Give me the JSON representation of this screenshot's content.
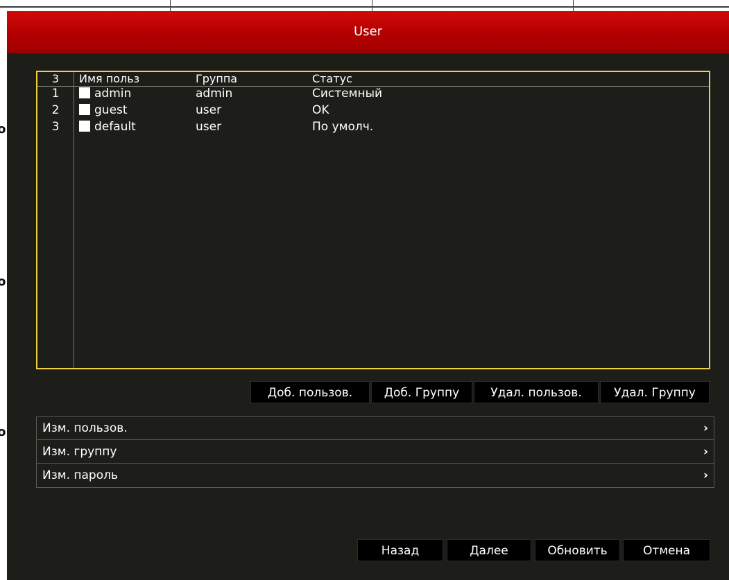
{
  "background": {
    "edge_glyphs": [
      "lo",
      "lo",
      "lo"
    ]
  },
  "dialog": {
    "title": "User",
    "colors": {
      "titlebar": "#c00000",
      "table_border": "#f2d03b",
      "panel": "#1d1d1a"
    }
  },
  "user_table": {
    "count_label": "3",
    "headers": {
      "name": "Имя польз",
      "group": "Группа",
      "status": "Статус"
    },
    "rows": [
      {
        "num": "1",
        "name": "admin",
        "group": "admin",
        "status": "Системный"
      },
      {
        "num": "2",
        "name": "guest",
        "group": "user",
        "status": "OK"
      },
      {
        "num": "3",
        "name": "default",
        "group": "user",
        "status": "По умолч."
      }
    ]
  },
  "actions": {
    "add_user": "Доб. пользов.",
    "add_group": "Доб. Группу",
    "delete_user": "Удал. пользов.",
    "delete_group": "Удал. Группу"
  },
  "menu": {
    "items": [
      {
        "label": "Изм. пользов.",
        "chevron": "›"
      },
      {
        "label": "Изм. группу",
        "chevron": "›"
      },
      {
        "label": "Изм. пароль",
        "chevron": "›"
      }
    ]
  },
  "footer": {
    "back": "Назад",
    "next": "Далее",
    "refresh": "Обновить",
    "cancel": "Отмена"
  }
}
